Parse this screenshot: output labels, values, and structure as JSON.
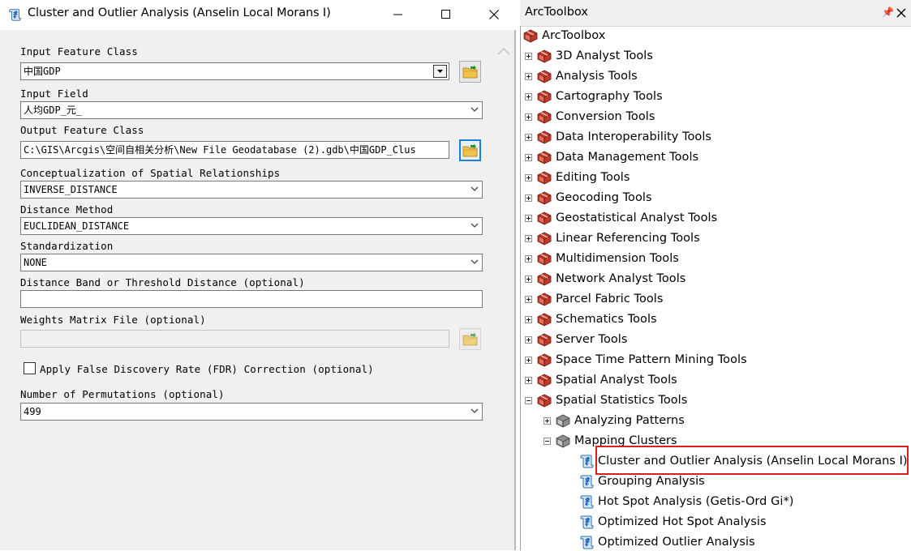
{
  "dialog": {
    "title": "Cluster and Outlier Analysis (Anselin Local Morans I)",
    "fields": {
      "input_feature_class": {
        "label": "Input Feature Class",
        "value": "中国GDP"
      },
      "input_field": {
        "label": "Input Field",
        "value": "人均GDP_元_"
      },
      "output_feature_class": {
        "label": "Output Feature Class",
        "value": "C:\\GIS\\Arcgis\\空间自相关分析\\New File Geodatabase (2).gdb\\中国GDP_Clus"
      },
      "conceptualization": {
        "label": "Conceptualization of Spatial Relationships",
        "value": "INVERSE_DISTANCE"
      },
      "distance_method": {
        "label": "Distance Method",
        "value": "EUCLIDEAN_DISTANCE"
      },
      "standardization": {
        "label": "Standardization",
        "value": "NONE"
      },
      "distance_band": {
        "label": "Distance Band or Threshold Distance (optional)",
        "value": ""
      },
      "weights_matrix": {
        "label": "Weights Matrix File (optional)",
        "value": ""
      },
      "fdr": {
        "label": "Apply False Discovery Rate (FDR) Correction (optional)",
        "checked": false
      },
      "permutations": {
        "label": "Number of Permutations (optional)",
        "value": "499"
      }
    }
  },
  "toolbox": {
    "title": "ArcToolbox",
    "root": "ArcToolbox",
    "toolboxes": [
      "3D Analyst Tools",
      "Analysis Tools",
      "Cartography Tools",
      "Conversion Tools",
      "Data Interoperability Tools",
      "Data Management Tools",
      "Editing Tools",
      "Geocoding Tools",
      "Geostatistical Analyst Tools",
      "Linear Referencing Tools",
      "Multidimension Tools",
      "Network Analyst Tools",
      "Parcel Fabric Tools",
      "Schematics Tools",
      "Server Tools",
      "Space Time Pattern Mining Tools",
      "Spatial Analyst Tools",
      "Spatial Statistics Tools"
    ],
    "spatial_stats_children": [
      "Analyzing Patterns",
      "Mapping Clusters"
    ],
    "mapping_clusters_tools": [
      "Cluster and Outlier Analysis (Anselin Local Morans I)",
      "Grouping Analysis",
      "Hot Spot Analysis (Getis-Ord Gi*)",
      "Optimized Hot Spot Analysis",
      "Optimized Outlier Analysis"
    ],
    "selected_tool": "Cluster and Outlier Analysis (Anselin Local Morans I)",
    "highlight_color": "#d9201f"
  },
  "colors": {
    "dialog_bg": "#f0f0f0",
    "active_border": "#1e7fd7",
    "toolbox_icon": "#b03a2e"
  }
}
